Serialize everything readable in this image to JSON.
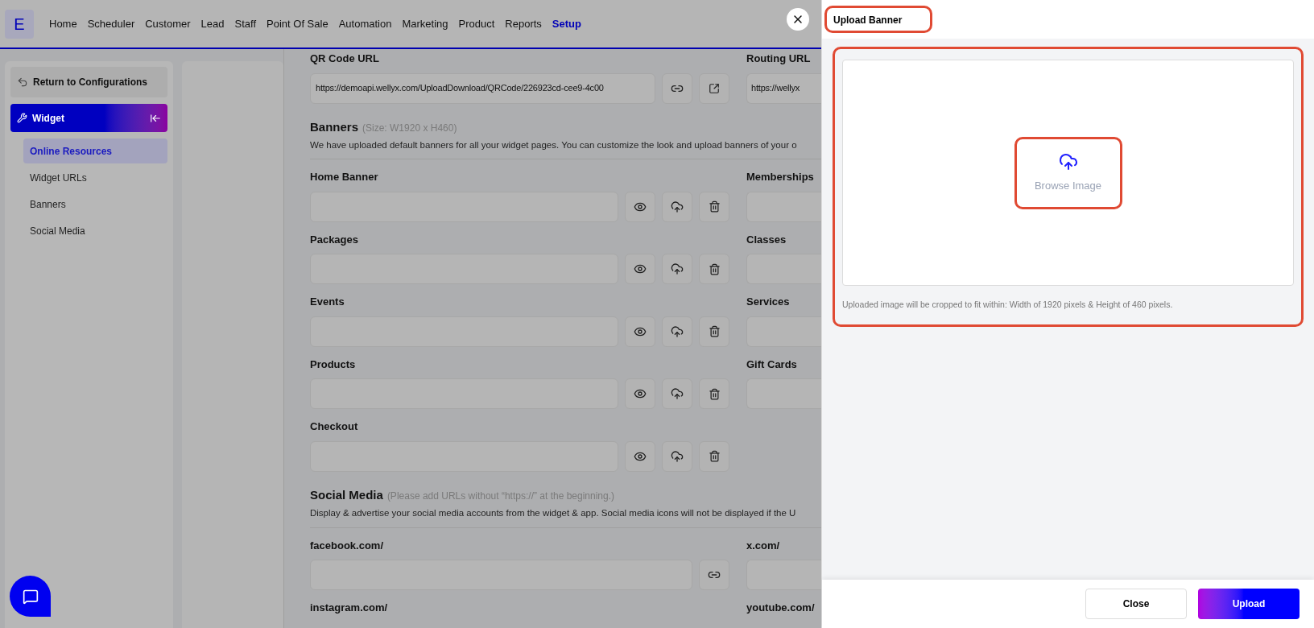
{
  "nav": {
    "logo": "E",
    "items": [
      {
        "label": "Home",
        "selected": false
      },
      {
        "label": "Scheduler",
        "selected": false
      },
      {
        "label": "Customer",
        "selected": false
      },
      {
        "label": "Lead",
        "selected": false
      },
      {
        "label": "Staff",
        "selected": false
      },
      {
        "label": "Point Of Sale",
        "selected": false
      },
      {
        "label": "Automation",
        "selected": false
      },
      {
        "label": "Marketing",
        "selected": false
      },
      {
        "label": "Product",
        "selected": false
      },
      {
        "label": "Reports",
        "selected": false
      },
      {
        "label": "Setup",
        "selected": true
      }
    ]
  },
  "sidebar": {
    "back": "Return to Configurations",
    "section": "Widget",
    "items": [
      {
        "label": "Online Resources",
        "selected": true
      },
      {
        "label": "Widget URLs",
        "selected": false
      },
      {
        "label": "Banners",
        "selected": false
      },
      {
        "label": "Social Media",
        "selected": false
      }
    ]
  },
  "content": {
    "qr": {
      "label": "QR Code URL",
      "value": "https://demoapi.wellyx.com/UploadDownload/QRCode/226923cd-cee9-4c00"
    },
    "routing": {
      "label": "Routing URL",
      "value": "https://wellyx"
    },
    "banners": {
      "title": "Banners",
      "note": "(Size: W1920 x H460)",
      "description": "We have uploaded default banners for all your widget pages. You can customize the look and upload banners of your o",
      "left": [
        "Home Banner",
        "Packages",
        "Events",
        "Products",
        "Checkout"
      ],
      "right": [
        "Memberships",
        "Classes",
        "Services",
        "Gift Cards"
      ]
    },
    "social": {
      "title": "Social Media",
      "note": "(Please add URLs without “https://” at the beginning.)",
      "description": "Display & advertise your social media accounts from the widget & app. Social media icons will not be displayed if the U",
      "left": [
        "facebook.com/",
        "instagram.com/"
      ],
      "right": [
        "x.com/",
        "youtube.com/"
      ]
    }
  },
  "drawer": {
    "title": "Upload Banner",
    "browse": "Browse Image",
    "hint": "Uploaded image will be cropped to fit within: Width of 1920 pixels & Height of 460 pixels.",
    "buttons": [
      "Close",
      "Upload"
    ]
  }
}
